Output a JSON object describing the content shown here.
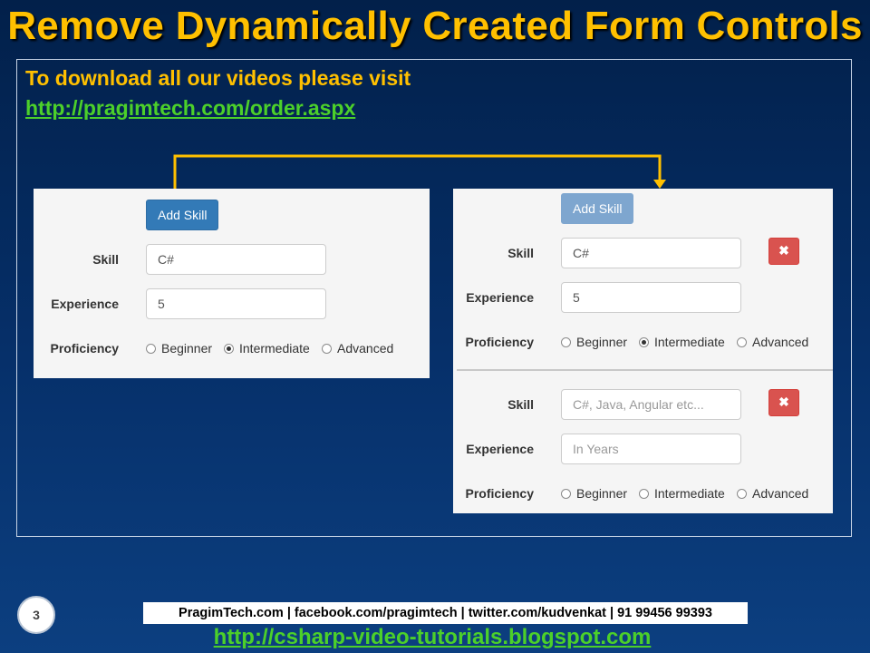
{
  "slide": {
    "title": "Remove Dynamically Created Form Controls",
    "download_text": "To download all our videos please visit",
    "download_link": "http://pragimtech.com/order.aspx",
    "page_number": "3",
    "footer_info": "PragimTech.com | facebook.com/pragimtech  | twitter.com/kudvenkat  | 91 99456 99393",
    "footer_link": "http://csharp-video-tutorials.blogspot.com"
  },
  "colors": {
    "title": "#ffc000",
    "link": "#4cd02a",
    "primary_button": "#337ab7",
    "danger_button": "#d9534f"
  },
  "left_form": {
    "add_button": "Add Skill",
    "skill_label": "Skill",
    "skill_value": "C#",
    "experience_label": "Experience",
    "experience_value": "5",
    "proficiency_label": "Proficiency",
    "options": [
      "Beginner",
      "Intermediate",
      "Advanced"
    ],
    "selected": "Intermediate"
  },
  "right_form": {
    "add_button": "Add Skill",
    "add_button_state": "disabled",
    "delete_icon": "x-icon",
    "groups": [
      {
        "skill_label": "Skill",
        "skill_value": "C#",
        "experience_label": "Experience",
        "experience_value": "5",
        "proficiency_label": "Proficiency",
        "options": [
          "Beginner",
          "Intermediate",
          "Advanced"
        ],
        "selected": "Intermediate"
      },
      {
        "skill_label": "Skill",
        "skill_placeholder": "C#, Java, Angular etc...",
        "experience_label": "Experience",
        "experience_placeholder": "In Years",
        "proficiency_label": "Proficiency",
        "options": [
          "Beginner",
          "Intermediate",
          "Advanced"
        ],
        "selected": ""
      }
    ]
  }
}
